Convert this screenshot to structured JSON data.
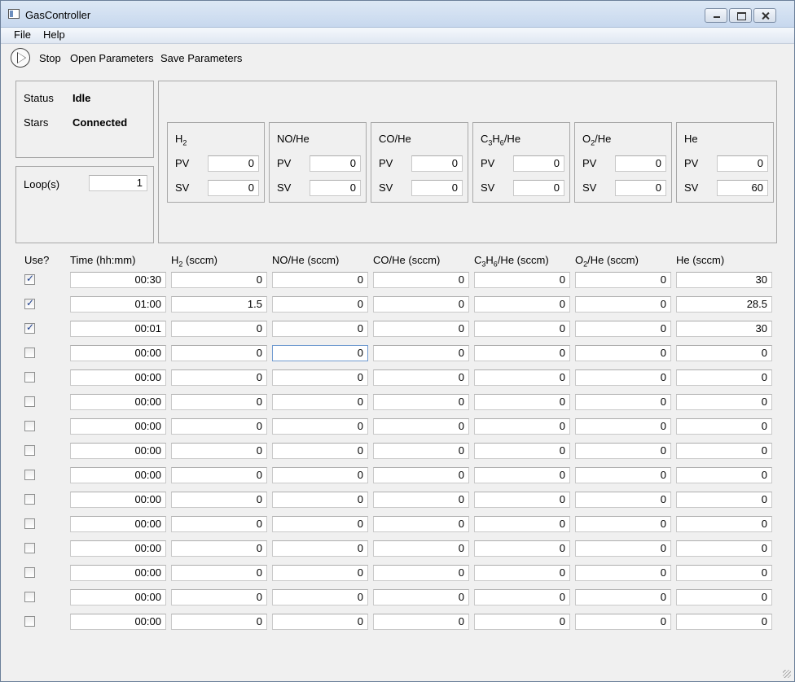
{
  "window": {
    "title": "GasController"
  },
  "menu": {
    "file": "File",
    "help": "Help"
  },
  "toolbar": {
    "stop": "Stop",
    "open": "Open Parameters",
    "save": "Save Parameters",
    "run_icon": "play-circle-icon"
  },
  "status": {
    "status_label": "Status",
    "status_value": "Idle",
    "stars_label": "Stars",
    "stars_value": "Connected",
    "loops_label": "Loop(s)",
    "loops_value": "1"
  },
  "gases": [
    {
      "name": "H",
      "sub": "2",
      "suffix": "",
      "pv": "0",
      "sv": "0"
    },
    {
      "name": "NO/He",
      "sub": "",
      "suffix": "",
      "pv": "0",
      "sv": "0"
    },
    {
      "name": "CO/He",
      "sub": "",
      "suffix": "",
      "pv": "0",
      "sv": "0"
    },
    {
      "name": "C3H6/He",
      "sub": "",
      "suffix": "",
      "pv": "0",
      "sv": "0"
    },
    {
      "name": "O2/He",
      "sub": "",
      "suffix": "",
      "pv": "0",
      "sv": "0"
    },
    {
      "name": "He",
      "sub": "",
      "suffix": "",
      "pv": "0",
      "sv": "60"
    }
  ],
  "labels": {
    "pv": "PV",
    "sv": "SV"
  },
  "table": {
    "headers": {
      "use": "Use?",
      "time": "Time (hh:mm)",
      "h2": "H2 (sccm)",
      "nohe": "NO/He (sccm)",
      "cohe": "CO/He (sccm)",
      "c3h6": "C3H6/He (sccm)",
      "o2": "O2/He (sccm)",
      "he": "He (sccm)"
    },
    "rows": [
      {
        "use": true,
        "vals": [
          "00:30",
          "0",
          "0",
          "0",
          "0",
          "0",
          "30"
        ]
      },
      {
        "use": true,
        "vals": [
          "01:00",
          "1.5",
          "0",
          "0",
          "0",
          "0",
          "28.5"
        ]
      },
      {
        "use": true,
        "vals": [
          "00:01",
          "0",
          "0",
          "0",
          "0",
          "0",
          "30"
        ]
      },
      {
        "use": false,
        "vals": [
          "00:00",
          "0",
          "0",
          "0",
          "0",
          "0",
          "0"
        ]
      },
      {
        "use": false,
        "vals": [
          "00:00",
          "0",
          "0",
          "0",
          "0",
          "0",
          "0"
        ]
      },
      {
        "use": false,
        "vals": [
          "00:00",
          "0",
          "0",
          "0",
          "0",
          "0",
          "0"
        ]
      },
      {
        "use": false,
        "vals": [
          "00:00",
          "0",
          "0",
          "0",
          "0",
          "0",
          "0"
        ]
      },
      {
        "use": false,
        "vals": [
          "00:00",
          "0",
          "0",
          "0",
          "0",
          "0",
          "0"
        ]
      },
      {
        "use": false,
        "vals": [
          "00:00",
          "0",
          "0",
          "0",
          "0",
          "0",
          "0"
        ]
      },
      {
        "use": false,
        "vals": [
          "00:00",
          "0",
          "0",
          "0",
          "0",
          "0",
          "0"
        ]
      },
      {
        "use": false,
        "vals": [
          "00:00",
          "0",
          "0",
          "0",
          "0",
          "0",
          "0"
        ]
      },
      {
        "use": false,
        "vals": [
          "00:00",
          "0",
          "0",
          "0",
          "0",
          "0",
          "0"
        ]
      },
      {
        "use": false,
        "vals": [
          "00:00",
          "0",
          "0",
          "0",
          "0",
          "0",
          "0"
        ]
      },
      {
        "use": false,
        "vals": [
          "00:00",
          "0",
          "0",
          "0",
          "0",
          "0",
          "0"
        ]
      },
      {
        "use": false,
        "vals": [
          "00:00",
          "0",
          "0",
          "0",
          "0",
          "0",
          "0"
        ]
      }
    ]
  }
}
